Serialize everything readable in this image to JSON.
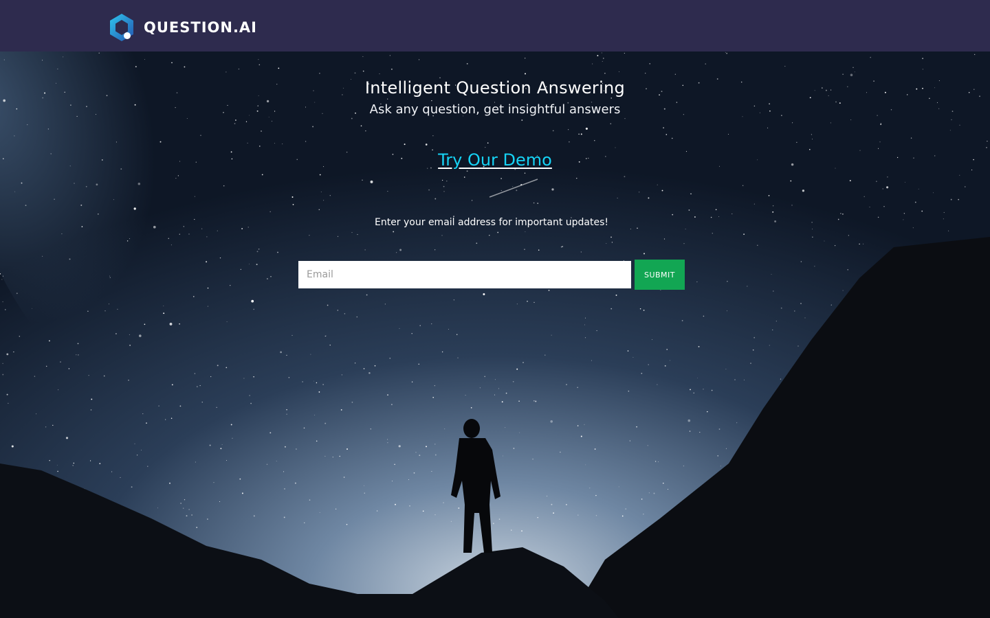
{
  "header": {
    "brand": "QUESTION.AI"
  },
  "hero": {
    "title": "Intelligent Question Answering",
    "subtitle": "Ask any question, get insightful answers",
    "demo_link": "Try Our Demo",
    "updates_text": "Enter your email address for important updates!"
  },
  "form": {
    "email_placeholder": "Email",
    "email_value": "",
    "submit_label": "SUBMIT"
  },
  "colors": {
    "header_bg": "#2e2b4e",
    "link": "#16d3f5",
    "submit_bg": "#12a653",
    "logo_cyan": "#2bb7e6",
    "logo_blue": "#2a5fb8"
  }
}
